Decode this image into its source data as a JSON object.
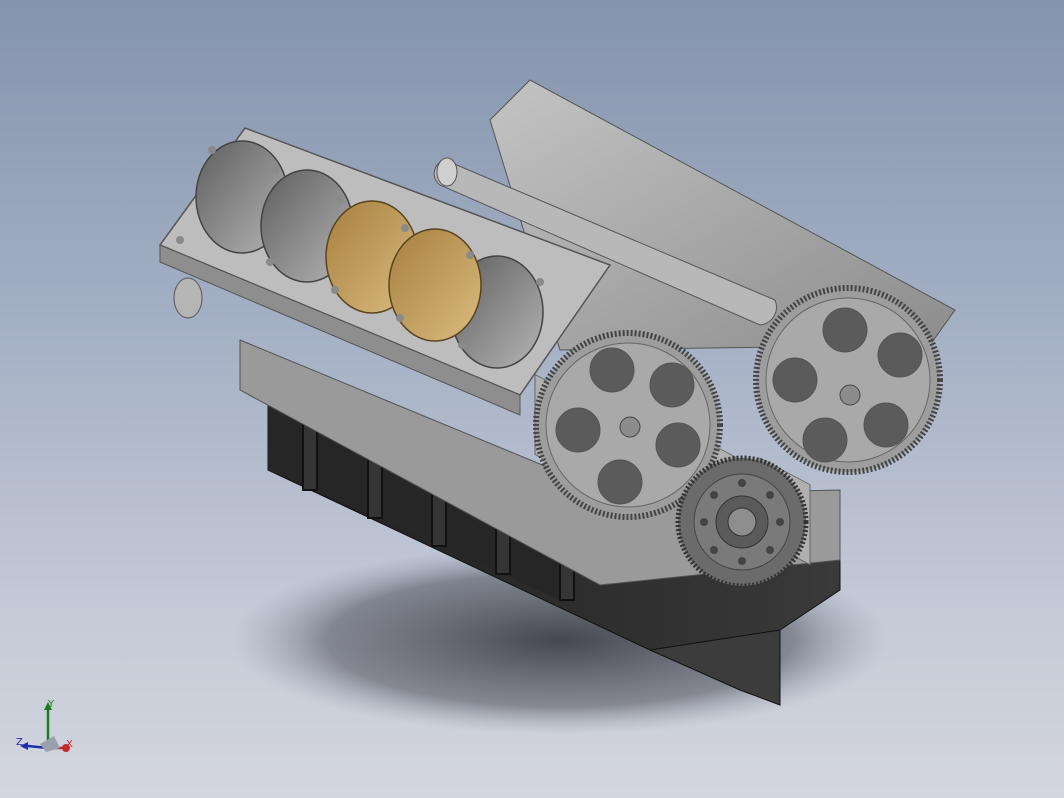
{
  "viewport": {
    "title": "",
    "background_top": "#8494ad",
    "background_bottom": "#d3d6de"
  },
  "model": {
    "part_color": "#a3a3a3",
    "oil_pan_color": "#2a2a2a",
    "piston_color": "#c9a466",
    "shadow_color": "#3a3a3a"
  },
  "triad": {
    "x_label": "X",
    "y_label": "Y",
    "z_label": "Z",
    "x_color": "#c22a2a",
    "y_color": "#1c7d1c",
    "z_color": "#1c2fa8"
  }
}
